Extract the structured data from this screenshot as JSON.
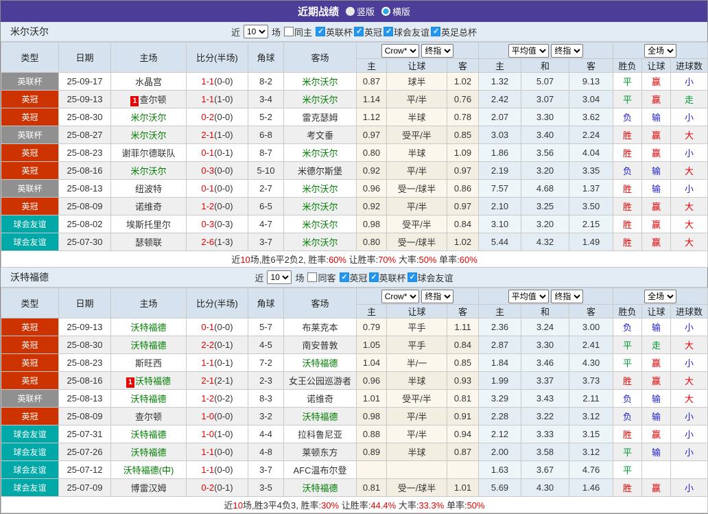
{
  "title_bar": {
    "title": "近期战绩",
    "options": [
      {
        "label": "竖版",
        "selected": false
      },
      {
        "label": "横版",
        "selected": true
      }
    ]
  },
  "colors": {
    "titlebar": "#4b3d98",
    "header_bg": "#d6e3ef",
    "control_bg": "#e3ecf4",
    "focus_team": "#008000",
    "score_red": "#e60000",
    "result_red": "#e60000",
    "result_green": "#009933",
    "result_blue": "#2222cc",
    "type_badges": {
      "英联杯": "#909090",
      "英冠": "#cc3300",
      "球会友谊": "#00a8a8"
    }
  },
  "controls_common": {
    "near": "近",
    "count": "10",
    "games": "场"
  },
  "table_header": {
    "type": "类型",
    "date": "日期",
    "home": "主场",
    "score": "比分(半场)",
    "corner": "角球",
    "away": "客场",
    "odds_source_select": "Crow*",
    "odds_final_select": "终指",
    "avg_source_select": "平均值",
    "avg_final_select": "终指",
    "scope_select": "全场",
    "odds_sub": [
      "主",
      "让球",
      "客"
    ],
    "avg_sub": [
      "主",
      "和",
      "客"
    ],
    "result_sub": [
      "胜负",
      "让球",
      "进球数"
    ]
  },
  "sections": [
    {
      "team": "米尔沃尔",
      "same_side": "同主",
      "same_side_checked": false,
      "leagues": [
        "英联杯",
        "英冠",
        "球会友谊",
        "英足总杯"
      ],
      "rows": [
        {
          "league": "英联杯",
          "date": "25-09-17",
          "home": {
            "name": "水晶宫",
            "focus": false,
            "badge": ""
          },
          "score": {
            "ft": "1-1",
            "ht": "(0-0)"
          },
          "corner": "8-2",
          "away": {
            "name": "米尔沃尔",
            "focus": true,
            "badge": ""
          },
          "odds": [
            "0.87",
            "球半",
            "1.02"
          ],
          "avg": [
            "1.32",
            "5.07",
            "9.13"
          ],
          "outcome": [
            [
              "平",
              "green"
            ],
            [
              "赢",
              "red"
            ],
            [
              "小",
              "blue"
            ]
          ]
        },
        {
          "league": "英冠",
          "date": "25-09-13",
          "home": {
            "name": "查尔顿",
            "focus": false,
            "badge": "1"
          },
          "score": {
            "ft": "1-1",
            "ht": "(1-0)"
          },
          "corner": "3-4",
          "away": {
            "name": "米尔沃尔",
            "focus": true,
            "badge": ""
          },
          "odds": [
            "1.14",
            "平/半",
            "0.76"
          ],
          "avg": [
            "2.42",
            "3.07",
            "3.04"
          ],
          "outcome": [
            [
              "平",
              "green"
            ],
            [
              "赢",
              "red"
            ],
            [
              "走",
              "green"
            ]
          ]
        },
        {
          "league": "英冠",
          "date": "25-08-30",
          "home": {
            "name": "米尔沃尔",
            "focus": true,
            "badge": ""
          },
          "score": {
            "ft": "0-2",
            "ht": "(0-0)"
          },
          "corner": "5-2",
          "away": {
            "name": "雷克瑟姆",
            "focus": false,
            "badge": ""
          },
          "odds": [
            "1.12",
            "半球",
            "0.78"
          ],
          "avg": [
            "2.07",
            "3.30",
            "3.62"
          ],
          "outcome": [
            [
              "负",
              "blue"
            ],
            [
              "输",
              "blue"
            ],
            [
              "小",
              "blue"
            ]
          ]
        },
        {
          "league": "英联杯",
          "date": "25-08-27",
          "home": {
            "name": "米尔沃尔",
            "focus": true,
            "badge": ""
          },
          "score": {
            "ft": "2-1",
            "ht": "(1-0)"
          },
          "corner": "6-8",
          "away": {
            "name": "考文垂",
            "focus": false,
            "badge": ""
          },
          "odds": [
            "0.97",
            "受平/半",
            "0.85"
          ],
          "avg": [
            "3.03",
            "3.40",
            "2.24"
          ],
          "outcome": [
            [
              "胜",
              "red"
            ],
            [
              "赢",
              "red"
            ],
            [
              "大",
              "red"
            ]
          ]
        },
        {
          "league": "英冠",
          "date": "25-08-23",
          "home": {
            "name": "谢菲尔德联队",
            "focus": false,
            "badge": ""
          },
          "score": {
            "ft": "0-1",
            "ht": "(0-1)"
          },
          "corner": "8-7",
          "away": {
            "name": "米尔沃尔",
            "focus": true,
            "badge": ""
          },
          "odds": [
            "0.80",
            "半球",
            "1.09"
          ],
          "avg": [
            "1.86",
            "3.56",
            "4.04"
          ],
          "outcome": [
            [
              "胜",
              "red"
            ],
            [
              "赢",
              "red"
            ],
            [
              "小",
              "blue"
            ]
          ]
        },
        {
          "league": "英冠",
          "date": "25-08-16",
          "home": {
            "name": "米尔沃尔",
            "focus": true,
            "badge": ""
          },
          "score": {
            "ft": "0-3",
            "ht": "(0-0)"
          },
          "corner": "5-10",
          "away": {
            "name": "米德尔斯堡",
            "focus": false,
            "badge": ""
          },
          "odds": [
            "0.92",
            "平/半",
            "0.97"
          ],
          "avg": [
            "2.19",
            "3.20",
            "3.35"
          ],
          "outcome": [
            [
              "负",
              "blue"
            ],
            [
              "输",
              "blue"
            ],
            [
              "大",
              "red"
            ]
          ]
        },
        {
          "league": "英联杯",
          "date": "25-08-13",
          "home": {
            "name": "纽波特",
            "focus": false,
            "badge": ""
          },
          "score": {
            "ft": "0-1",
            "ht": "(0-0)"
          },
          "corner": "2-7",
          "away": {
            "name": "米尔沃尔",
            "focus": true,
            "badge": ""
          },
          "odds": [
            "0.96",
            "受一/球半",
            "0.86"
          ],
          "avg": [
            "7.57",
            "4.68",
            "1.37"
          ],
          "outcome": [
            [
              "胜",
              "red"
            ],
            [
              "输",
              "blue"
            ],
            [
              "小",
              "blue"
            ]
          ]
        },
        {
          "league": "英冠",
          "date": "25-08-09",
          "home": {
            "name": "诺维奇",
            "focus": false,
            "badge": ""
          },
          "score": {
            "ft": "1-2",
            "ht": "(0-0)"
          },
          "corner": "6-5",
          "away": {
            "name": "米尔沃尔",
            "focus": true,
            "badge": ""
          },
          "odds": [
            "0.92",
            "平/半",
            "0.97"
          ],
          "avg": [
            "2.10",
            "3.25",
            "3.50"
          ],
          "outcome": [
            [
              "胜",
              "red"
            ],
            [
              "赢",
              "red"
            ],
            [
              "大",
              "red"
            ]
          ]
        },
        {
          "league": "球会友谊",
          "date": "25-08-02",
          "home": {
            "name": "埃斯托里尔",
            "focus": false,
            "badge": ""
          },
          "score": {
            "ft": "0-3",
            "ht": "(0-3)"
          },
          "corner": "4-7",
          "away": {
            "name": "米尔沃尔",
            "focus": true,
            "badge": ""
          },
          "odds": [
            "0.98",
            "受平/半",
            "0.84"
          ],
          "avg": [
            "3.10",
            "3.20",
            "2.15"
          ],
          "outcome": [
            [
              "胜",
              "red"
            ],
            [
              "赢",
              "red"
            ],
            [
              "大",
              "red"
            ]
          ]
        },
        {
          "league": "球会友谊",
          "date": "25-07-30",
          "home": {
            "name": "瑟顿联",
            "focus": false,
            "badge": ""
          },
          "score": {
            "ft": "2-6",
            "ht": "(1-3)"
          },
          "corner": "3-7",
          "away": {
            "name": "米尔沃尔",
            "focus": true,
            "badge": ""
          },
          "odds": [
            "0.80",
            "受一/球半",
            "1.02"
          ],
          "avg": [
            "5.44",
            "4.32",
            "1.49"
          ],
          "outcome": [
            [
              "胜",
              "red"
            ],
            [
              "赢",
              "red"
            ],
            [
              "大",
              "red"
            ]
          ]
        }
      ],
      "summary": [
        {
          "t": "近",
          "r": false
        },
        {
          "t": "10",
          "r": true
        },
        {
          "t": "场,胜6平2负2, 胜率:",
          "r": false
        },
        {
          "t": "60%",
          "r": true
        },
        {
          "t": " 让胜率:",
          "r": false
        },
        {
          "t": "70%",
          "r": true
        },
        {
          "t": " 大率:",
          "r": false
        },
        {
          "t": "50%",
          "r": true
        },
        {
          "t": " 单率:",
          "r": false
        },
        {
          "t": "60%",
          "r": true
        }
      ]
    },
    {
      "team": "沃特福德",
      "same_side": "同客",
      "same_side_checked": false,
      "leagues": [
        "英冠",
        "英联杯",
        "球会友谊"
      ],
      "rows": [
        {
          "league": "英冠",
          "date": "25-09-13",
          "home": {
            "name": "沃特福德",
            "focus": true,
            "badge": ""
          },
          "score": {
            "ft": "0-1",
            "ht": "(0-0)"
          },
          "corner": "5-7",
          "away": {
            "name": "布莱克本",
            "focus": false,
            "badge": ""
          },
          "odds": [
            "0.79",
            "平手",
            "1.11"
          ],
          "avg": [
            "2.36",
            "3.24",
            "3.00"
          ],
          "outcome": [
            [
              "负",
              "blue"
            ],
            [
              "输",
              "blue"
            ],
            [
              "小",
              "blue"
            ]
          ]
        },
        {
          "league": "英冠",
          "date": "25-08-30",
          "home": {
            "name": "沃特福德",
            "focus": true,
            "badge": ""
          },
          "score": {
            "ft": "2-2",
            "ht": "(0-1)"
          },
          "corner": "4-5",
          "away": {
            "name": "南安普敦",
            "focus": false,
            "badge": ""
          },
          "odds": [
            "1.05",
            "平手",
            "0.84"
          ],
          "avg": [
            "2.87",
            "3.30",
            "2.41"
          ],
          "outcome": [
            [
              "平",
              "green"
            ],
            [
              "走",
              "green"
            ],
            [
              "大",
              "red"
            ]
          ]
        },
        {
          "league": "英冠",
          "date": "25-08-23",
          "home": {
            "name": "斯旺西",
            "focus": false,
            "badge": ""
          },
          "score": {
            "ft": "1-1",
            "ht": "(0-1)"
          },
          "corner": "7-2",
          "away": {
            "name": "沃特福德",
            "focus": true,
            "badge": ""
          },
          "odds": [
            "1.04",
            "半/一",
            "0.85"
          ],
          "avg": [
            "1.84",
            "3.46",
            "4.30"
          ],
          "outcome": [
            [
              "平",
              "green"
            ],
            [
              "赢",
              "red"
            ],
            [
              "小",
              "blue"
            ]
          ]
        },
        {
          "league": "英冠",
          "date": "25-08-16",
          "home": {
            "name": "沃特福德",
            "focus": true,
            "badge": "1"
          },
          "score": {
            "ft": "2-1",
            "ht": "(2-1)"
          },
          "corner": "2-3",
          "away": {
            "name": "女王公园巡游者",
            "focus": false,
            "badge": ""
          },
          "odds": [
            "0.96",
            "半球",
            "0.93"
          ],
          "avg": [
            "1.99",
            "3.37",
            "3.73"
          ],
          "outcome": [
            [
              "胜",
              "red"
            ],
            [
              "赢",
              "red"
            ],
            [
              "大",
              "red"
            ]
          ]
        },
        {
          "league": "英联杯",
          "date": "25-08-13",
          "home": {
            "name": "沃特福德",
            "focus": true,
            "badge": ""
          },
          "score": {
            "ft": "1-2",
            "ht": "(0-2)"
          },
          "corner": "8-3",
          "away": {
            "name": "诺维奇",
            "focus": false,
            "badge": ""
          },
          "odds": [
            "1.01",
            "受平/半",
            "0.81"
          ],
          "avg": [
            "3.29",
            "3.43",
            "2.11"
          ],
          "outcome": [
            [
              "负",
              "blue"
            ],
            [
              "输",
              "blue"
            ],
            [
              "大",
              "red"
            ]
          ]
        },
        {
          "league": "英冠",
          "date": "25-08-09",
          "home": {
            "name": "查尔顿",
            "focus": false,
            "badge": ""
          },
          "score": {
            "ft": "1-0",
            "ht": "(0-0)"
          },
          "corner": "3-2",
          "away": {
            "name": "沃特福德",
            "focus": true,
            "badge": ""
          },
          "odds": [
            "0.98",
            "平/半",
            "0.91"
          ],
          "avg": [
            "2.28",
            "3.22",
            "3.12"
          ],
          "outcome": [
            [
              "负",
              "blue"
            ],
            [
              "输",
              "blue"
            ],
            [
              "小",
              "blue"
            ]
          ]
        },
        {
          "league": "球会友谊",
          "date": "25-07-31",
          "home": {
            "name": "沃特福德",
            "focus": true,
            "badge": ""
          },
          "score": {
            "ft": "1-0",
            "ht": "(1-0)"
          },
          "corner": "4-4",
          "away": {
            "name": "拉科鲁尼亚",
            "focus": false,
            "badge": ""
          },
          "odds": [
            "0.88",
            "平/半",
            "0.94"
          ],
          "avg": [
            "2.12",
            "3.33",
            "3.15"
          ],
          "outcome": [
            [
              "胜",
              "red"
            ],
            [
              "赢",
              "red"
            ],
            [
              "小",
              "blue"
            ]
          ]
        },
        {
          "league": "球会友谊",
          "date": "25-07-26",
          "home": {
            "name": "沃特福德",
            "focus": true,
            "badge": ""
          },
          "score": {
            "ft": "1-1",
            "ht": "(0-0)"
          },
          "corner": "4-8",
          "away": {
            "name": "莱顿东方",
            "focus": false,
            "badge": ""
          },
          "odds": [
            "0.89",
            "半球",
            "0.87"
          ],
          "avg": [
            "2.00",
            "3.58",
            "3.12"
          ],
          "outcome": [
            [
              "平",
              "green"
            ],
            [
              "输",
              "blue"
            ],
            [
              "小",
              "blue"
            ]
          ]
        },
        {
          "league": "球会友谊",
          "date": "25-07-12",
          "home": {
            "name": "沃特福德(中)",
            "focus": true,
            "badge": ""
          },
          "score": {
            "ft": "1-1",
            "ht": "(0-0)"
          },
          "corner": "3-7",
          "away": {
            "name": "AFC温布尔登",
            "focus": false,
            "badge": ""
          },
          "odds": [
            "",
            "",
            ""
          ],
          "avg": [
            "1.63",
            "3.67",
            "4.76"
          ],
          "outcome": [
            [
              "平",
              "green"
            ],
            [
              "",
              ""
            ],
            [
              "",
              ""
            ]
          ]
        },
        {
          "league": "球会友谊",
          "date": "25-07-09",
          "home": {
            "name": "博雷汉姆",
            "focus": false,
            "badge": ""
          },
          "score": {
            "ft": "0-2",
            "ht": "(0-1)"
          },
          "corner": "3-5",
          "away": {
            "name": "沃特福德",
            "focus": true,
            "badge": ""
          },
          "odds": [
            "0.81",
            "受一/球半",
            "1.01"
          ],
          "avg": [
            "5.69",
            "4.30",
            "1.46"
          ],
          "outcome": [
            [
              "胜",
              "red"
            ],
            [
              "赢",
              "red"
            ],
            [
              "小",
              "blue"
            ]
          ]
        }
      ],
      "summary": [
        {
          "t": "近",
          "r": false
        },
        {
          "t": "10",
          "r": true
        },
        {
          "t": "场,胜3平4负3, 胜率:",
          "r": false
        },
        {
          "t": "30%",
          "r": true
        },
        {
          "t": " 让胜率:",
          "r": false
        },
        {
          "t": "44.4%",
          "r": true
        },
        {
          "t": " 大率:",
          "r": false
        },
        {
          "t": "33.3%",
          "r": true
        },
        {
          "t": " 单率:",
          "r": false
        },
        {
          "t": "50%",
          "r": true
        }
      ]
    }
  ]
}
